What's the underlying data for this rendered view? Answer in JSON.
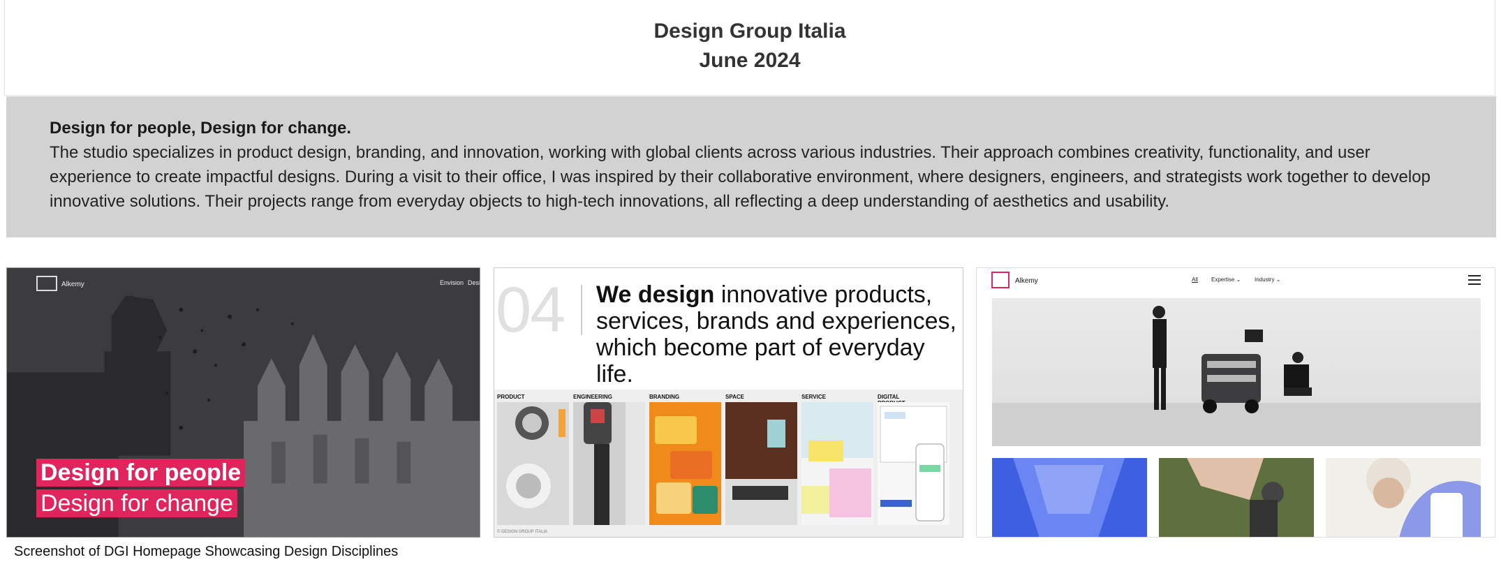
{
  "header": {
    "title": "Design Group Italia",
    "date": "June 2024"
  },
  "intro": {
    "headline": "Design for people, Design for change.",
    "body": "The studio specializes in product design, branding, and innovation, working with global clients across various industries. Their approach combines creativity, functionality, and user experience to create impactful designs. During a visit to their office, I was inspired by their collaborative environment, where designers, engineers, and strategists work together to develop innovative solutions. Their projects range from everyday objects to high-tech innovations, all reflecting a deep understanding of aesthetics and usability."
  },
  "screenshot1": {
    "logo_text": "Alkemy",
    "nav": [
      "Envision",
      "Desig"
    ],
    "hero_line1": "Design for people",
    "hero_line2": "Design for change"
  },
  "screenshot2": {
    "number": "04",
    "tagline_bold": "We design",
    "tagline_rest": " innovative products, services, brands and experiences, which become part of everyday life.",
    "categories": [
      "PRODUCT",
      "ENGINEERING",
      "BRANDING",
      "SPACE",
      "SERVICE",
      "DIGITAL PRODUCT"
    ],
    "copyright": "© DESIGN GROUP ITALIA"
  },
  "screenshot3": {
    "logo_text": "Alkemy",
    "nav": [
      "All",
      "Expertise",
      "Industry"
    ]
  },
  "caption": "Screenshot of DGI Homepage Showcasing Design Disciplines",
  "colors": {
    "accent": "#e0245c",
    "intro_bg": "#d2d2d2"
  }
}
